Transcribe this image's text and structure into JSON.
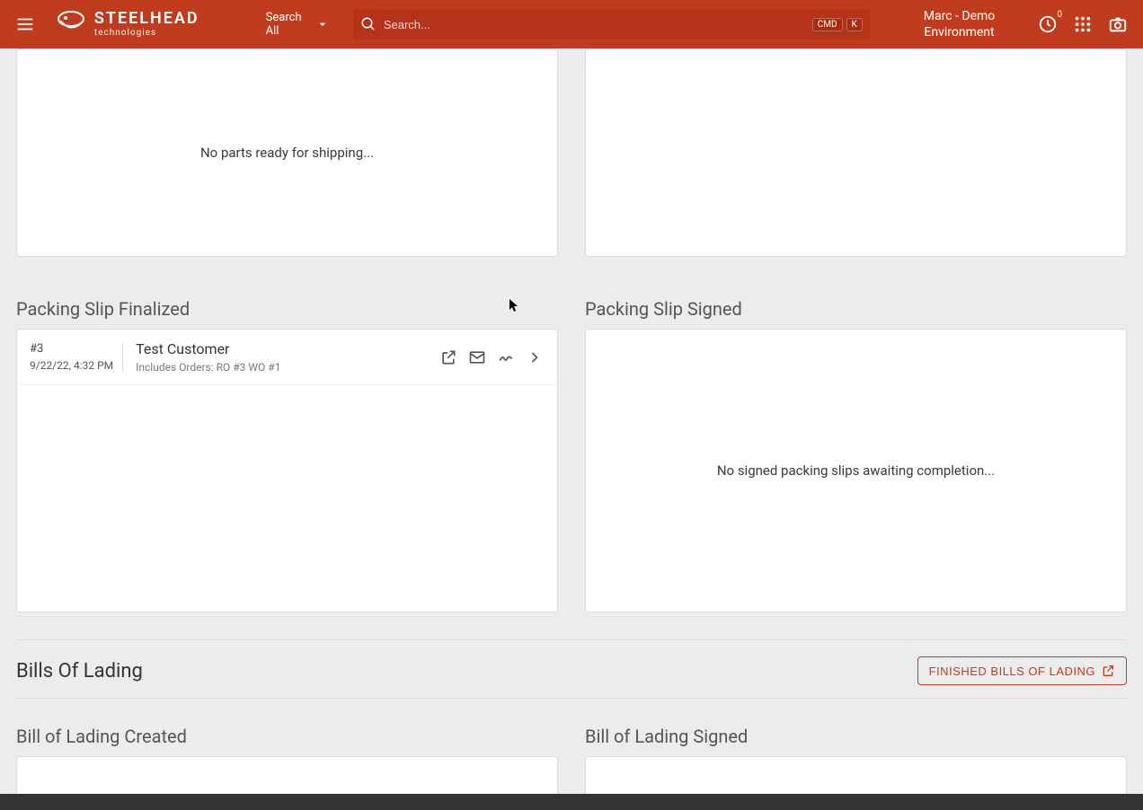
{
  "header": {
    "brand_main": "STEELHEAD",
    "brand_sub": "technologies",
    "search_all_label": "Search All",
    "search_placeholder": "Search...",
    "kbd_cmd": "CMD",
    "kbd_k": "K",
    "environment": "Marc - Demo Environment",
    "notif_count": "0"
  },
  "shipping_panel": {
    "empty_msg": "No parts ready for shipping..."
  },
  "packing_finalized": {
    "title": "Packing Slip Finalized",
    "item": {
      "id": "#3",
      "date": "9/22/22, 4:32 PM",
      "customer": "Test Customer",
      "orders": "Includes Orders: RO #3 WO #1"
    }
  },
  "packing_signed": {
    "title": "Packing Slip Signed",
    "empty_msg": "No signed packing slips awaiting completion..."
  },
  "bills_of_lading": {
    "title": "Bills Of Lading",
    "finished_button": "FINISHED BILLS OF LADING",
    "created_title": "Bill of Lading Created",
    "signed_title": "Bill of Lading Signed"
  }
}
